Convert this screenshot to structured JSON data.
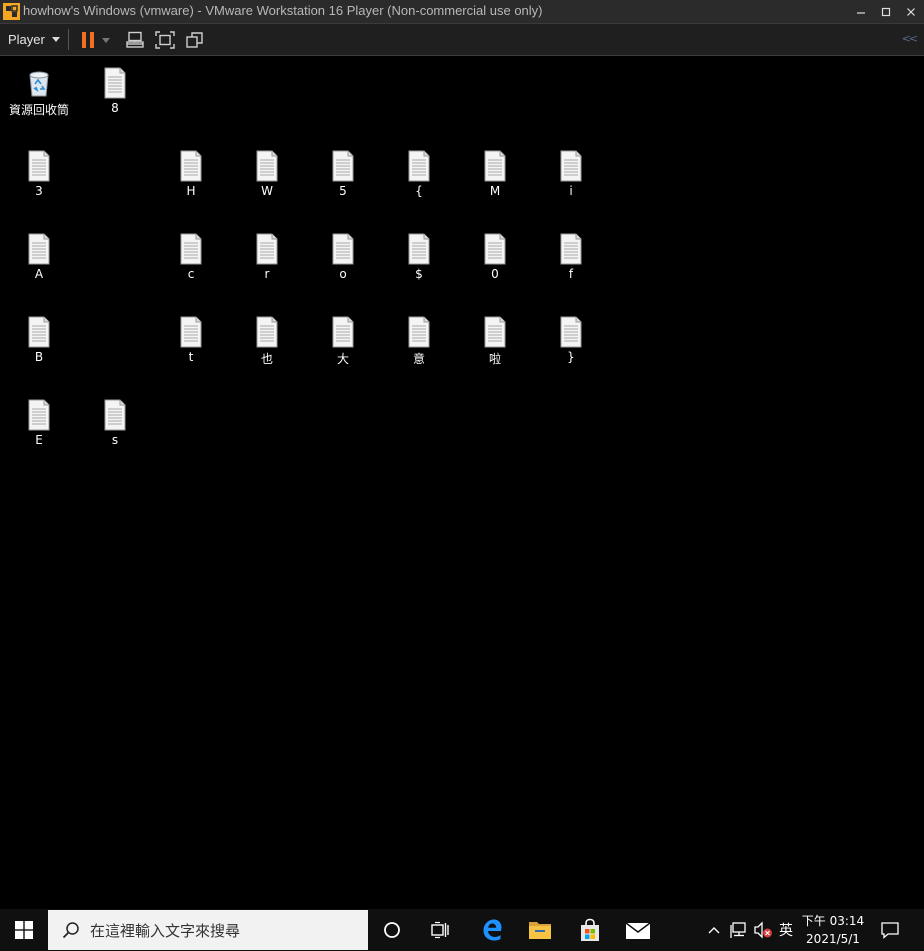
{
  "window": {
    "title": "howhow's Windows (vmware) - VMware Workstation 16 Player (Non-commercial use only)",
    "minimize_icon": "minimize-icon",
    "maximize_icon": "maximize-icon",
    "close_icon": "close-icon"
  },
  "toolbar": {
    "player_menu_label": "Player",
    "pause_color": "#f36f21",
    "collapse_label": "<<"
  },
  "desktop": {
    "recycle_bin_label": "資源回收筒",
    "files": [
      {
        "label": "8"
      },
      {
        "label": "3"
      },
      {
        "label": "H"
      },
      {
        "label": "W"
      },
      {
        "label": "5"
      },
      {
        "label": "{"
      },
      {
        "label": "M"
      },
      {
        "label": "i"
      },
      {
        "label": "A"
      },
      {
        "label": "c"
      },
      {
        "label": "r"
      },
      {
        "label": "o"
      },
      {
        "label": "$"
      },
      {
        "label": "0"
      },
      {
        "label": "f"
      },
      {
        "label": "B"
      },
      {
        "label": "t"
      },
      {
        "label": "也"
      },
      {
        "label": "大"
      },
      {
        "label": "意"
      },
      {
        "label": "啦"
      },
      {
        "label": "}"
      },
      {
        "label": "E"
      },
      {
        "label": "s"
      }
    ]
  },
  "taskbar": {
    "search_placeholder": "在這裡輸入文字來搜尋",
    "ime_label": "英",
    "time": "下午 03:14",
    "date": "2021/5/1",
    "edge_color": "#1e90ff",
    "folder_color": "#f6c343"
  }
}
